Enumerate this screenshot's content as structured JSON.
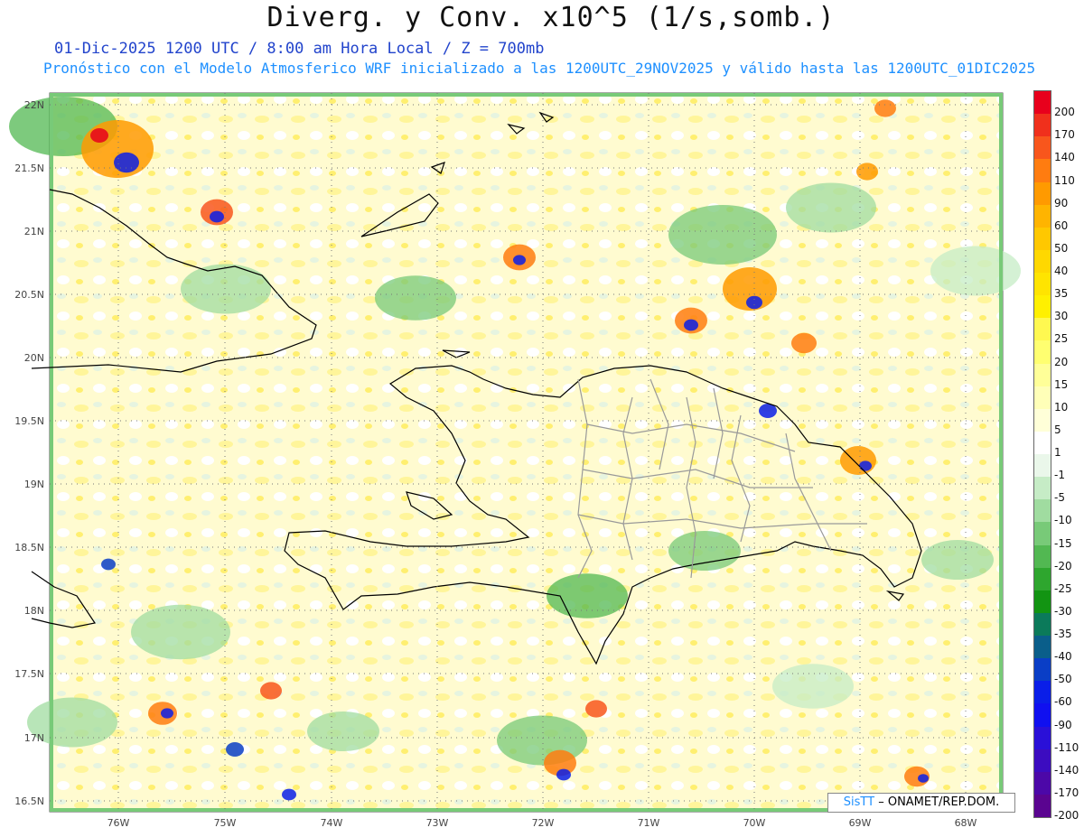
{
  "title": "Diverg. y Conv. x10^5 (1/s,somb.)",
  "subtitle1": "01-Dic-2025  1200 UTC / 8:00 am Hora Local / Z = 700mb",
  "subtitle2": "Pronóstico con el Modelo Atmosferico WRF inicializado a las 1200UTC_29NOV2025 y válido hasta las  1200UTC_01DIC2025",
  "credit": {
    "brand": "SisTT",
    "text": "– ONAMET/REP.DOM."
  },
  "lat_labels": [
    "22N",
    "21.5N",
    "21N",
    "20.5N",
    "20N",
    "19.5N",
    "19N",
    "18.5N",
    "18N",
    "17.5N",
    "17N",
    "16.5N"
  ],
  "lon_labels": [
    "76W",
    "75W",
    "74W",
    "73W",
    "72W",
    "71W",
    "70W",
    "69W",
    "68W"
  ],
  "colorbar": {
    "labels": [
      "200",
      "170",
      "140",
      "110",
      "90",
      "60",
      "50",
      "40",
      "35",
      "30",
      "25",
      "20",
      "15",
      "10",
      "5",
      "1",
      "-1",
      "-5",
      "-10",
      "-15",
      "-20",
      "-25",
      "-30",
      "-35",
      "-40",
      "-50",
      "-60",
      "-90",
      "-110",
      "-140",
      "-170",
      "-200"
    ],
    "colors": [
      "#e8001c",
      "#f0301c",
      "#f8561c",
      "#ff7c10",
      "#ff9a00",
      "#ffb400",
      "#ffc800",
      "#ffd800",
      "#ffe400",
      "#fff000",
      "#fff850",
      "#ffff70",
      "#ffff98",
      "#ffffb8",
      "#ffffd8",
      "#ffffff",
      "#eaf7ea",
      "#c6ecc6",
      "#a0dca0",
      "#78ca78",
      "#52b852",
      "#2ea62e",
      "#129412",
      "#0b7a5a",
      "#0a5e8a",
      "#0a3ec6",
      "#0a1ee8",
      "#1010f0",
      "#2a10d8",
      "#3c0cc0",
      "#4c08a8",
      "#5a0490"
    ]
  }
}
